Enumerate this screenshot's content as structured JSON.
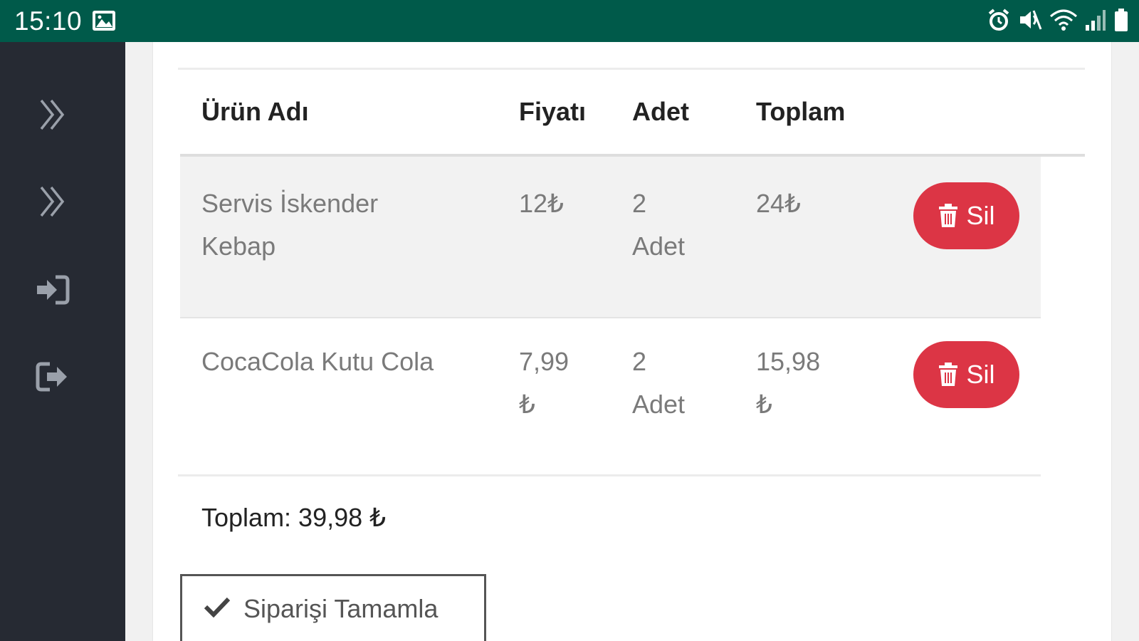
{
  "status_bar": {
    "time": "15:10",
    "icons": [
      "gallery-icon",
      "alarm-icon",
      "mute-icon",
      "wifi-icon",
      "signal-icon",
      "battery-icon"
    ],
    "color": "#005a4a"
  },
  "sidebar": {
    "items": [
      {
        "icon": "double-chevron-right-icon"
      },
      {
        "icon": "double-chevron-right-icon"
      },
      {
        "icon": "sign-in-icon"
      },
      {
        "icon": "sign-out-icon"
      }
    ],
    "color": "#262a33"
  },
  "table": {
    "headers": [
      "Ürün Adı",
      "Fiyatı",
      "Adet",
      "Toplam"
    ],
    "rows": [
      {
        "name_line1": "Servis İskender",
        "name_line2": "Kebap",
        "price_line1": "12₺",
        "price_line2": "",
        "qty_line1": "2",
        "qty_line2": "Adet",
        "total_line1": "24₺",
        "total_line2": "",
        "delete_label": "Sil"
      },
      {
        "name_line1": "CocaCola Kutu Cola",
        "name_line2": "",
        "price_line1": "7,99",
        "price_line2": "₺",
        "qty_line1": "2",
        "qty_line2": "Adet",
        "total_line1": "15,98",
        "total_line2": "₺",
        "delete_label": "Sil"
      }
    ]
  },
  "summary": {
    "total_text": "Toplam: 39,98 ₺"
  },
  "actions": {
    "complete_label": "Siparişi Tamamla"
  },
  "colors": {
    "danger": "#dc3545"
  }
}
